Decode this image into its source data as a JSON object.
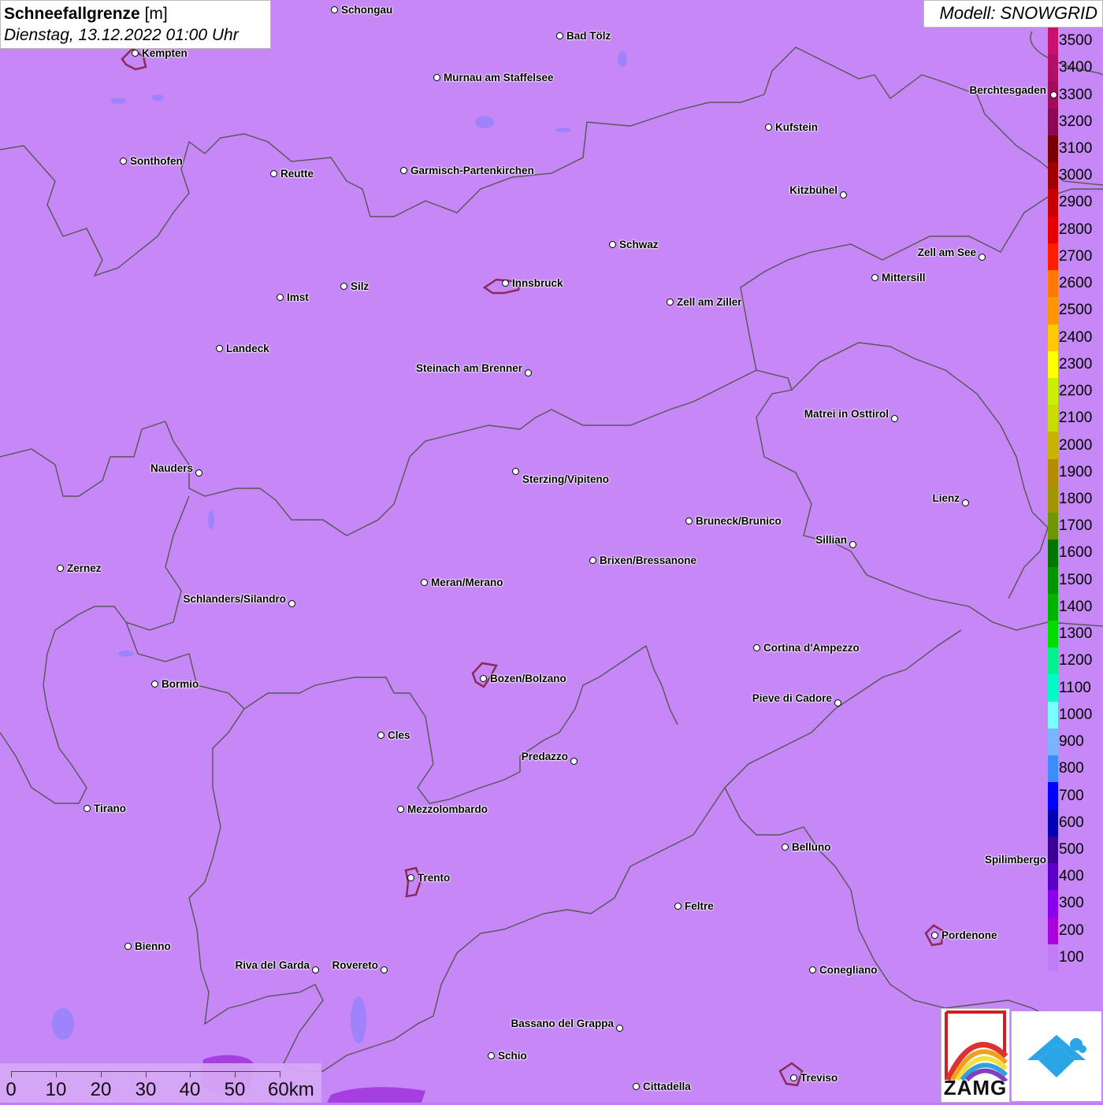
{
  "title": {
    "parameter_bold": "Schneefallgrenze",
    "unit": "[m]",
    "datetime": "Dienstag, 13.12.2022 01:00 Uhr"
  },
  "model_label": "Modell: SNOWGRID",
  "legend": {
    "levels": [
      {
        "label": "3500",
        "color": "#c8106e"
      },
      {
        "label": "3400",
        "color": "#b40f68"
      },
      {
        "label": "3300",
        "color": "#a00c5e"
      },
      {
        "label": "3200",
        "color": "#8a0a54"
      },
      {
        "label": "3100",
        "color": "#780000"
      },
      {
        "label": "3000",
        "color": "#a00000"
      },
      {
        "label": "2900",
        "color": "#c80000"
      },
      {
        "label": "2800",
        "color": "#e60000"
      },
      {
        "label": "2700",
        "color": "#ff1e00"
      },
      {
        "label": "2600",
        "color": "#ff7800"
      },
      {
        "label": "2500",
        "color": "#ff9600"
      },
      {
        "label": "2400",
        "color": "#ffc800"
      },
      {
        "label": "2300",
        "color": "#ffff00"
      },
      {
        "label": "2200",
        "color": "#c8f000"
      },
      {
        "label": "2100",
        "color": "#c8dc00"
      },
      {
        "label": "2000",
        "color": "#c8b400"
      },
      {
        "label": "1900",
        "color": "#b48c00"
      },
      {
        "label": "1800",
        "color": "#a09600"
      },
      {
        "label": "1700",
        "color": "#6e9600"
      },
      {
        "label": "1600",
        "color": "#007800"
      },
      {
        "label": "1500",
        "color": "#009600"
      },
      {
        "label": "1400",
        "color": "#00b400"
      },
      {
        "label": "1300",
        "color": "#00dc00"
      },
      {
        "label": "1200",
        "color": "#00f08c"
      },
      {
        "label": "1100",
        "color": "#00fac8"
      },
      {
        "label": "1000",
        "color": "#78ffff"
      },
      {
        "label": "900",
        "color": "#78b4ff"
      },
      {
        "label": "800",
        "color": "#3c8cff"
      },
      {
        "label": "700",
        "color": "#0000ff"
      },
      {
        "label": "600",
        "color": "#0000b4"
      },
      {
        "label": "500",
        "color": "#3c0096"
      },
      {
        "label": "400",
        "color": "#5a00c8"
      },
      {
        "label": "300",
        "color": "#8c00f0"
      },
      {
        "label": "200",
        "color": "#aa00dc"
      },
      {
        "label": "100",
        "color": "#c07cf5"
      }
    ]
  },
  "map": {
    "base_color": "#c07cf5",
    "border_color": "#555555",
    "cities": [
      {
        "name": "Schongau"
      },
      {
        "name": "Bad Tölz"
      },
      {
        "name": "Kempten"
      },
      {
        "name": "Murnau am Staffelsee"
      },
      {
        "name": "Berchtesgaden"
      },
      {
        "name": "Kufstein"
      },
      {
        "name": "Sonthofen"
      },
      {
        "name": "Reutte"
      },
      {
        "name": "Garmisch-Partenkirchen"
      },
      {
        "name": "Kitzbühel"
      },
      {
        "name": "Schwaz"
      },
      {
        "name": "Zell am See"
      },
      {
        "name": "Innsbruck"
      },
      {
        "name": "Mittersill"
      },
      {
        "name": "Imst"
      },
      {
        "name": "Silz"
      },
      {
        "name": "Zell am Ziller"
      },
      {
        "name": "Landeck"
      },
      {
        "name": "Steinach am Brenner"
      },
      {
        "name": "Matrei in Osttirol"
      },
      {
        "name": "Nauders"
      },
      {
        "name": "Sterzing/Vipiteno"
      },
      {
        "name": "Lienz"
      },
      {
        "name": "Bruneck/Brunico"
      },
      {
        "name": "Sillian"
      },
      {
        "name": "Zernez"
      },
      {
        "name": "Brixen/Bressanone"
      },
      {
        "name": "Meran/Merano"
      },
      {
        "name": "Schlanders/Silandro"
      },
      {
        "name": "Cortina d'Ampezzo"
      },
      {
        "name": "Bozen/Bolzano"
      },
      {
        "name": "Bormio"
      },
      {
        "name": "Pieve di Cadore"
      },
      {
        "name": "Cles"
      },
      {
        "name": "Predazzo"
      },
      {
        "name": "Tirano"
      },
      {
        "name": "Mezzolombardo"
      },
      {
        "name": "Belluno"
      },
      {
        "name": "Spilimbergo"
      },
      {
        "name": "Trento"
      },
      {
        "name": "Feltre"
      },
      {
        "name": "Bienno"
      },
      {
        "name": "Pordenone"
      },
      {
        "name": "Riva del Garda"
      },
      {
        "name": "Rovereto"
      },
      {
        "name": "Conegliano"
      },
      {
        "name": "Bassano del Grappa"
      },
      {
        "name": "Schio"
      },
      {
        "name": "Treviso"
      },
      {
        "name": "Cittadella"
      }
    ]
  },
  "scalebar": {
    "labels": [
      "0",
      "10",
      "20",
      "30",
      "40",
      "50",
      "60km"
    ]
  },
  "logos": {
    "zamg_text": "ZAMG"
  }
}
